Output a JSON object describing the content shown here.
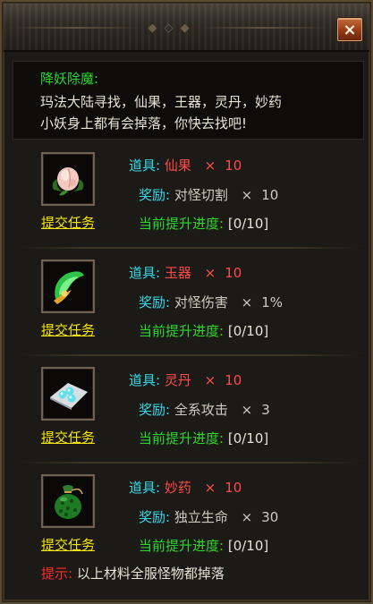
{
  "window": {
    "close_label": "×",
    "ornament": "◆ ◇ ◆"
  },
  "header": {
    "title": "降妖除魔:",
    "desc_line1": "玛法大陆寻找，仙果，王器，灵丹，妙药",
    "desc_line2": "小妖身上都有会掉落，你快去找吧!"
  },
  "labels": {
    "item": "道具:",
    "reward": "奖励:",
    "progress": "当前提升进度:",
    "submit": "提交任务",
    "times": "×"
  },
  "tasks": [
    {
      "icon": "peach-icon",
      "item": "仙果",
      "item_qty": "10",
      "reward": "对怪切割",
      "reward_qty": "10",
      "progress": "[0/10]"
    },
    {
      "icon": "jade-wing-icon",
      "item": "玉器",
      "item_qty": "10",
      "reward": "对怪伤害",
      "reward_qty": "1%",
      "progress": "[0/10]"
    },
    {
      "icon": "pill-icon",
      "item": "灵丹",
      "item_qty": "10",
      "reward": "全系攻击",
      "reward_qty": "3",
      "progress": "[0/10]"
    },
    {
      "icon": "potion-bag-icon",
      "item": "妙药",
      "item_qty": "10",
      "reward": "独立生命",
      "reward_qty": "30",
      "progress": "[0/10]"
    }
  ],
  "footer": {
    "hint_label": "提示:",
    "hint_text": "以上材料全服怪物都掉落"
  },
  "colors": {
    "cyan": "#35d9e5",
    "green": "#2fd52f",
    "red": "#ff4a4a",
    "yellow": "#f5e60a"
  }
}
